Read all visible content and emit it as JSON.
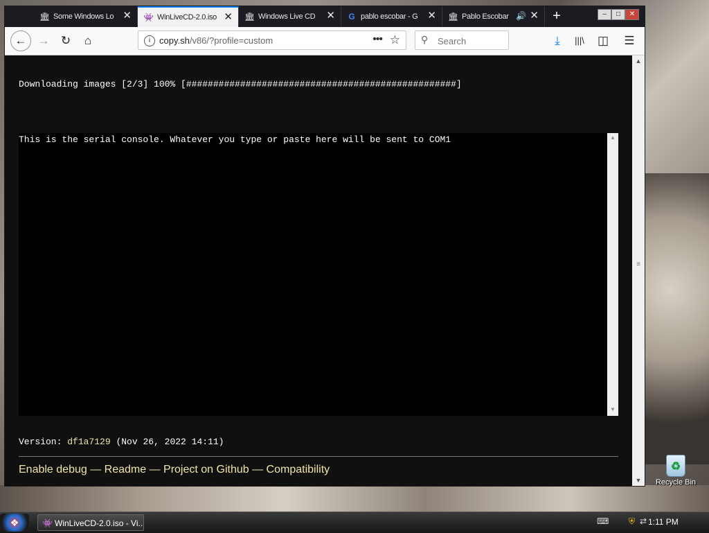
{
  "tabs": [
    {
      "label": "Some Windows Lo",
      "icon": "museum-icon",
      "close": "✕"
    },
    {
      "label": "WinLiveCD-2.0.iso",
      "icon": "v86-icon",
      "close": "✕",
      "active": true
    },
    {
      "label": "Windows Live CD",
      "icon": "museum-icon",
      "close": "✕"
    },
    {
      "label": "pablo escobar - G",
      "icon": "google-icon",
      "close": "✕"
    },
    {
      "label": "Pablo Escobar",
      "icon": "museum-icon",
      "close": "✕"
    }
  ],
  "new_tab": "+",
  "window_controls": {
    "minimize": "–",
    "maximize": "□",
    "close": "✕"
  },
  "nav": {
    "back": "←",
    "forward": "→",
    "reload": "↻",
    "home": "⌂"
  },
  "address": {
    "info": "i",
    "host": "copy.sh",
    "path": "/v86/?profile=custom",
    "more": "•••",
    "star": "☆"
  },
  "search": {
    "placeholder": "Search"
  },
  "toolbar_icons": {
    "download": "⤓",
    "library": "|||\\",
    "sidebar": "◫",
    "menu": "☰"
  },
  "page": {
    "download_status": "Downloading images [2/3] 100% [##################################################]",
    "console_message": "This is the serial console. Whatever you type or paste here will be sent to COM1",
    "version_label": "Version: ",
    "version_hash": "df1a7129",
    "version_date": " (Nov 26, 2022 14:11)",
    "links": [
      "Enable debug",
      "Readme",
      "Project on Github",
      "Compatibility"
    ],
    "separator": " — "
  },
  "desktop": {
    "recycle_bin": "Recycle Bin"
  },
  "taskbar": {
    "task_label": "WinLiveCD-2.0.iso - Vi...",
    "clock": "1:11 PM"
  }
}
